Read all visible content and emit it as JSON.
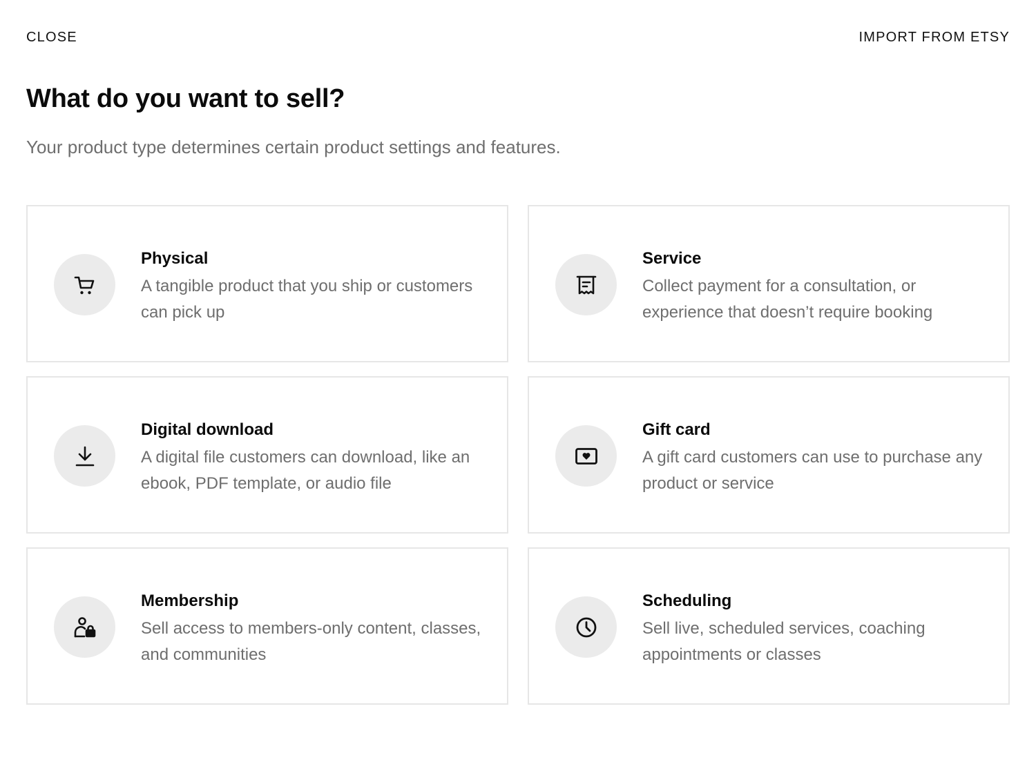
{
  "header": {
    "close_label": "CLOSE",
    "import_label": "IMPORT FROM ETSY"
  },
  "title": "What do you want to sell?",
  "subtitle": "Your product type determines certain product settings and features.",
  "options": [
    {
      "title": "Physical",
      "description": "A tangible product that you ship or customers can pick up",
      "icon": "shopping-cart-icon"
    },
    {
      "title": "Service",
      "description": "Collect payment for a consultation, or experience that doesn’t require booking",
      "icon": "receipt-icon"
    },
    {
      "title": "Digital download",
      "description": "A digital file customers can download, like an ebook, PDF template, or audio file",
      "icon": "download-icon"
    },
    {
      "title": "Gift card",
      "description": "A gift card customers can use to purchase any product or service",
      "icon": "gift-card-icon"
    },
    {
      "title": "Membership",
      "description": "Sell access to members-only content, classes, and communities",
      "icon": "member-lock-icon"
    },
    {
      "title": "Scheduling",
      "description": "Sell live, scheduled services, coaching appointments or classes",
      "icon": "clock-icon"
    }
  ],
  "colors": {
    "icon_circle_bg": "#ebebeb",
    "card_border": "#e6e6e6",
    "muted_text": "#6e6e6e",
    "primary_text": "#0b0b0b"
  }
}
